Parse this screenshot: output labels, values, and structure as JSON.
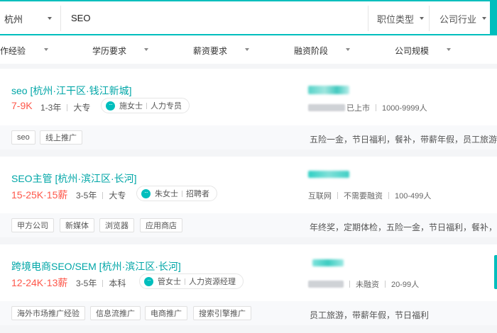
{
  "search": {
    "city": "杭州",
    "query": "SEO",
    "filter_jobtype": "职位类型",
    "filter_industry": "公司行业"
  },
  "filters": [
    "作经验",
    "学历要求",
    "薪资要求",
    "融资阶段",
    "公司规模"
  ],
  "jobs": [
    {
      "title": "seo  [杭州·江干区·钱江新城]",
      "salary": "7-9K",
      "experience": "1-3年",
      "education": "大专",
      "recruiter_name": "施女士",
      "recruiter_role": "人力专员",
      "company_stage": "已上市",
      "company_size": "1000-9999人",
      "tags": [
        "seo",
        "线上推广"
      ],
      "benefits": "五险一金，节日福利，餐补，带薪年假，员工旅游，"
    },
    {
      "title": "SEO主管  [杭州·滨江区·长河]",
      "salary": "15-25K·15薪",
      "experience": "3-5年",
      "education": "大专",
      "recruiter_name": "朱女士",
      "recruiter_role": "招聘者",
      "company_industry": "互联网",
      "company_stage": "不需要融资",
      "company_size": "100-499人",
      "tags": [
        "甲方公司",
        "新媒体",
        "浏览器",
        "应用商店"
      ],
      "benefits": "年终奖，定期体检，五险一金，节日福利，餐补，员"
    },
    {
      "title": "跨境电商SEO/SEM  [杭州·滨江区·长河]",
      "salary": "12-24K·13薪",
      "experience": "3-5年",
      "education": "本科",
      "recruiter_name": "管女士",
      "recruiter_role": "人力资源经理",
      "company_stage": "未融资",
      "company_size": "20-99人",
      "tags": [
        "海外市场推广经验",
        "信息流推广",
        "电商推广",
        "搜索引擎推广"
      ],
      "benefits": "员工旅游，带薪年假，节日福利"
    }
  ],
  "colors": {
    "accent": "#00bebd",
    "salary": "#fe574a",
    "title": "#00a6a7"
  }
}
